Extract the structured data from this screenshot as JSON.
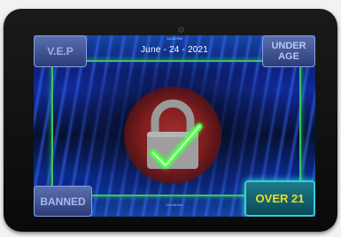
{
  "status_bar": {
    "time": "12:31 PM"
  },
  "date": "June - 24 - 2021",
  "buttons": {
    "vep": "V.E.P",
    "under_age": "UNDER AGE",
    "banned": "BANNED",
    "over_21": "OVER 21"
  },
  "footer": {
    "logo_text": "IDentiFake"
  },
  "colors": {
    "frame": "#38c46a",
    "check": "#4cff4c",
    "over_text": "#e6e020",
    "circle": "#8a1f1f"
  },
  "icons": {
    "center": "padlock-check-icon"
  }
}
